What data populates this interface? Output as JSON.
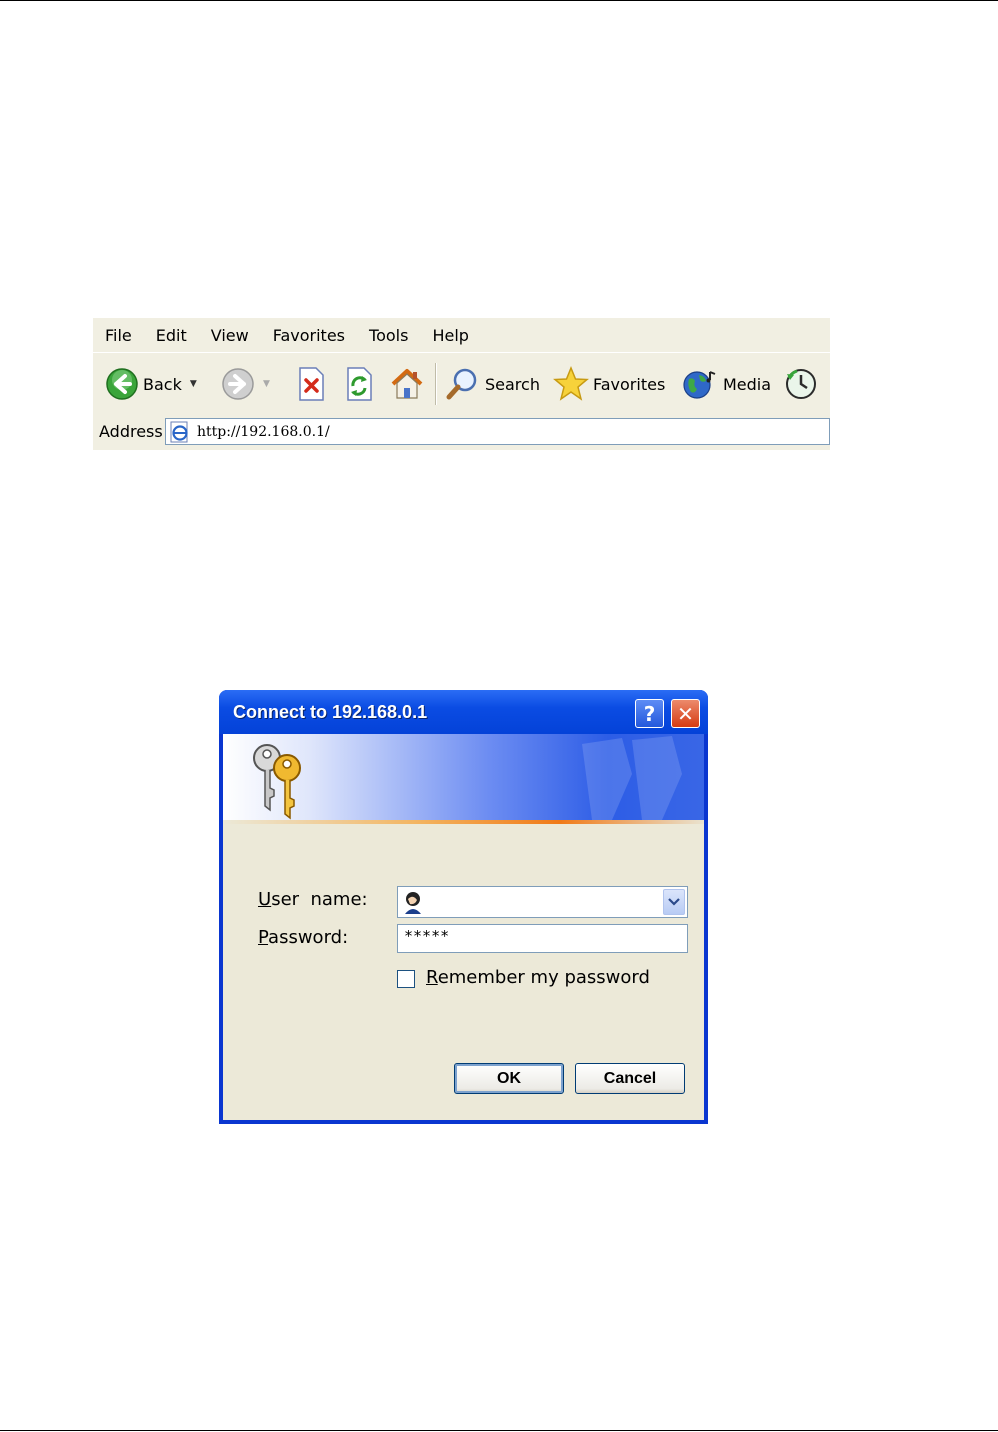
{
  "browser": {
    "menu": [
      "File",
      "Edit",
      "View",
      "Favorites",
      "Tools",
      "Help"
    ],
    "toolbar": {
      "back_label": "Back",
      "search_label": "Search",
      "favorites_label": "Favorites",
      "media_label": "Media"
    },
    "address": {
      "label": "Address",
      "url": "http://192.168.0.1/"
    }
  },
  "dialog": {
    "title": "Connect to 192.168.0.1",
    "help_glyph": "?",
    "close_glyph": "✕",
    "username": {
      "label_first": "U",
      "label_rest": "ser  name:",
      "value": ""
    },
    "password": {
      "label_first": "P",
      "label_rest": "assword:",
      "value": "*****"
    },
    "remember": {
      "label_first": "R",
      "label_rest": "emember my password",
      "checked": false
    },
    "ok_label": "OK",
    "cancel_label": "Cancel"
  },
  "colors": {
    "titlebar": "#0442d8",
    "dialog_body": "#ece9d8",
    "toolbar": "#f1efe2"
  }
}
